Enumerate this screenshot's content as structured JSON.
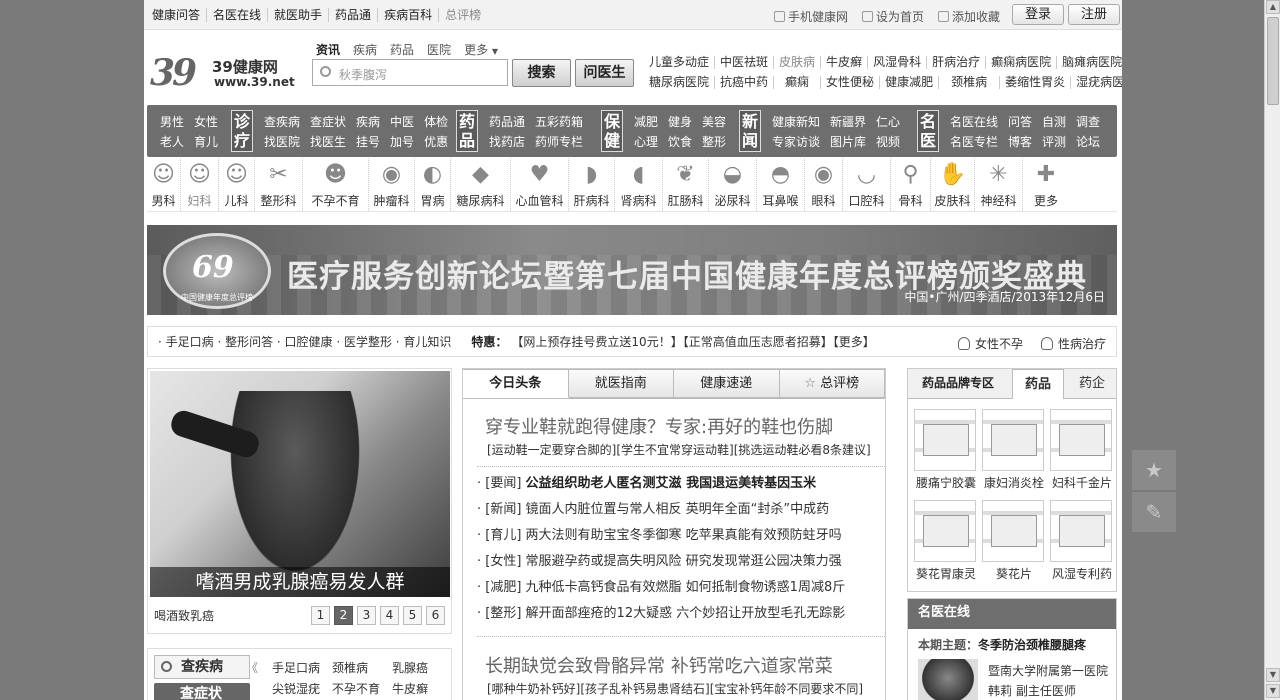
{
  "topbar": {
    "nav": [
      "健康问答",
      "名医在线",
      "就医助手",
      "药品通",
      "疾病百科",
      "总评榜"
    ],
    "links": [
      "手机健康网",
      "设为首页",
      "添加收藏"
    ],
    "login": "登录",
    "register": "注册"
  },
  "logo": {
    "mark": "39",
    "name": "39健康网",
    "url": "www.39.net"
  },
  "search": {
    "tabs": [
      "资讯",
      "疾病",
      "药品",
      "医院",
      "更多"
    ],
    "placeholder": "秋季腹泻",
    "search_btn": "搜索",
    "ask_btn": "问医生"
  },
  "hot": {
    "row1": [
      "儿童多动症",
      "中医祛斑",
      "皮肤病",
      "牛皮癣",
      "风湿骨科",
      "肝病治疗",
      "癫痫病医院",
      "脑瘫病医院"
    ],
    "row2": [
      "糖尿病医院",
      "抗癌中药",
      "癫痫",
      "女性便秘",
      "健康减肥",
      "颈椎病",
      "萎缩性胃炎",
      "湿疣病医院"
    ]
  },
  "darknav": {
    "g1": {
      "r1": [
        "男性",
        "女性"
      ],
      "r2": [
        "老人",
        "育儿"
      ]
    },
    "zhenliao": "诊疗",
    "g2": {
      "r1": [
        "查疾病",
        "查症状",
        "疾病",
        "中医",
        "体检"
      ],
      "r2": [
        "找医院",
        "找医生",
        "挂号",
        "加号",
        "优惠"
      ]
    },
    "yaopin": "药品",
    "g3": {
      "r1": [
        "药品通",
        "五彩药箱"
      ],
      "r2": [
        "找药店",
        "药师专栏"
      ]
    },
    "baojian": "保健",
    "g4": {
      "r1": [
        "减肥",
        "健身",
        "美容"
      ],
      "r2": [
        "心理",
        "饮食",
        "整形"
      ]
    },
    "xinwen": "新闻",
    "g5": {
      "r1": [
        "健康新知",
        "新疆界",
        "仁心"
      ],
      "r2": [
        "专家访谈",
        "图片库",
        "视频"
      ]
    },
    "mingyi": "名医",
    "g6": {
      "r1": [
        "名医在线",
        "问答",
        "自测",
        "调查"
      ],
      "r2": [
        "名医专栏",
        "博客",
        "评测",
        "论坛"
      ]
    }
  },
  "depts": [
    {
      "label": "男科",
      "icon": "man-icon"
    },
    {
      "label": "妇科",
      "icon": "woman-icon"
    },
    {
      "label": "儿科",
      "icon": "child-icon"
    },
    {
      "label": "整形科",
      "icon": "plastic-icon"
    },
    {
      "label": "不孕不育",
      "icon": "infertility-icon"
    },
    {
      "label": "肿瘤科",
      "icon": "tumor-icon"
    },
    {
      "label": "胃病",
      "icon": "stomach-icon"
    },
    {
      "label": "糖尿病科",
      "icon": "diabetes-icon"
    },
    {
      "label": "心血管科",
      "icon": "heart-icon"
    },
    {
      "label": "肝病科",
      "icon": "liver-icon"
    },
    {
      "label": "肾病科",
      "icon": "kidney-icon"
    },
    {
      "label": "肛肠科",
      "icon": "intestine-icon"
    },
    {
      "label": "泌尿科",
      "icon": "bladder-icon"
    },
    {
      "label": "耳鼻喉",
      "icon": "ear-icon"
    },
    {
      "label": "眼科",
      "icon": "eye-icon"
    },
    {
      "label": "口腔科",
      "icon": "mouth-icon"
    },
    {
      "label": "骨科",
      "icon": "bone-icon"
    },
    {
      "label": "皮肤科",
      "icon": "skin-icon"
    },
    {
      "label": "神经科",
      "icon": "nerve-icon"
    },
    {
      "label": "更多",
      "icon": "plus-icon"
    }
  ],
  "banner": {
    "badge_num": "69",
    "badge_sub": "中国健康年度总评榜",
    "title": "医疗服务创新论坛暨第七届中国健康年度总评榜颁奖盛典",
    "place": "中国•广州/四季酒店/2013年12月6日"
  },
  "ticker": {
    "links": "· 手足口病 · 整形问答 · 口腔健康 · 医学整形 · 育儿知识",
    "label": "特惠：",
    "text": "【网上预存挂号费立送10元！】【正常高值血压志愿者招募】【更多】",
    "right": [
      "女性不孕",
      "性病治疗"
    ]
  },
  "photo": {
    "caption": "嗜酒男成乳腺癌易发人群",
    "footer": "喝酒致乳癌",
    "pages": [
      "1",
      "2",
      "3",
      "4",
      "5",
      "6"
    ],
    "active_page": "2"
  },
  "checker": {
    "title": "查疾病",
    "title2": "查症状",
    "arrow": "《",
    "items": [
      "手足口病",
      "颈椎病",
      "乳腺癌",
      "尖锐湿疣",
      "不孕不育",
      "牛皮癣"
    ]
  },
  "news": {
    "tabs": [
      "今日头条",
      "就医指南",
      "健康速递",
      "总评榜"
    ],
    "headline": "穿专业鞋就跑得健康？专家:再好的鞋也伤脚",
    "subline": "[运动鞋一定要穿合脚的][学生不宜常穿运动鞋][挑选运动鞋必看8条建议]",
    "items": [
      {
        "tag": "· [要闻] ",
        "bold": "公益组织助老人匿名测艾滋 我国退运美转基因玉米",
        "text": ""
      },
      {
        "tag": "· [新闻] ",
        "bold": "",
        "text": "镜面人内脏位置与常人相反 英明年全面“封杀”中成药"
      },
      {
        "tag": "· [育儿] ",
        "bold": "",
        "text": "两大法则有助宝宝冬季御寒 吃苹果真能有效预防蛀牙吗"
      },
      {
        "tag": "· [女性] ",
        "bold": "",
        "text": "常服避孕药或提高失明风险 研究发现常逛公园决策力强"
      },
      {
        "tag": "· [减肥] ",
        "bold": "",
        "text": "九种低卡高钙食品有效燃脂 如何抵制食物诱惑1周减8斤"
      },
      {
        "tag": "· [整形] ",
        "bold": "",
        "text": "解开面部痤疮的12大疑惑 六个妙招让开放型毛孔无踪影"
      }
    ],
    "headline2": "长期缺觉会致骨骼异常 补钙常吃六道家常菜",
    "subline2": "[哪种牛奶补钙好][孩子乱补钙易患肾结石][宝宝补钙年龄不同要求不同]"
  },
  "drugs": {
    "tabs": [
      "药品品牌专区",
      "药品",
      "药企"
    ],
    "items": [
      "腰痛宁胶囊",
      "康妇消炎栓",
      "妇科千金片",
      "葵花胃康灵",
      "葵花片",
      "风湿专利药"
    ]
  },
  "doctor": {
    "title": "名医在线",
    "topic_label": "本期主题：",
    "topic": "冬季防治颈椎腰腿疼",
    "hospital": "暨南大学附属第一医院",
    "name": "韩莉  副主任医师"
  },
  "floattools": [
    "star-icon",
    "edit-icon"
  ],
  "colors": {
    "nav_bg": "#6e6e6e",
    "page_bg": "#7a7a7a"
  }
}
